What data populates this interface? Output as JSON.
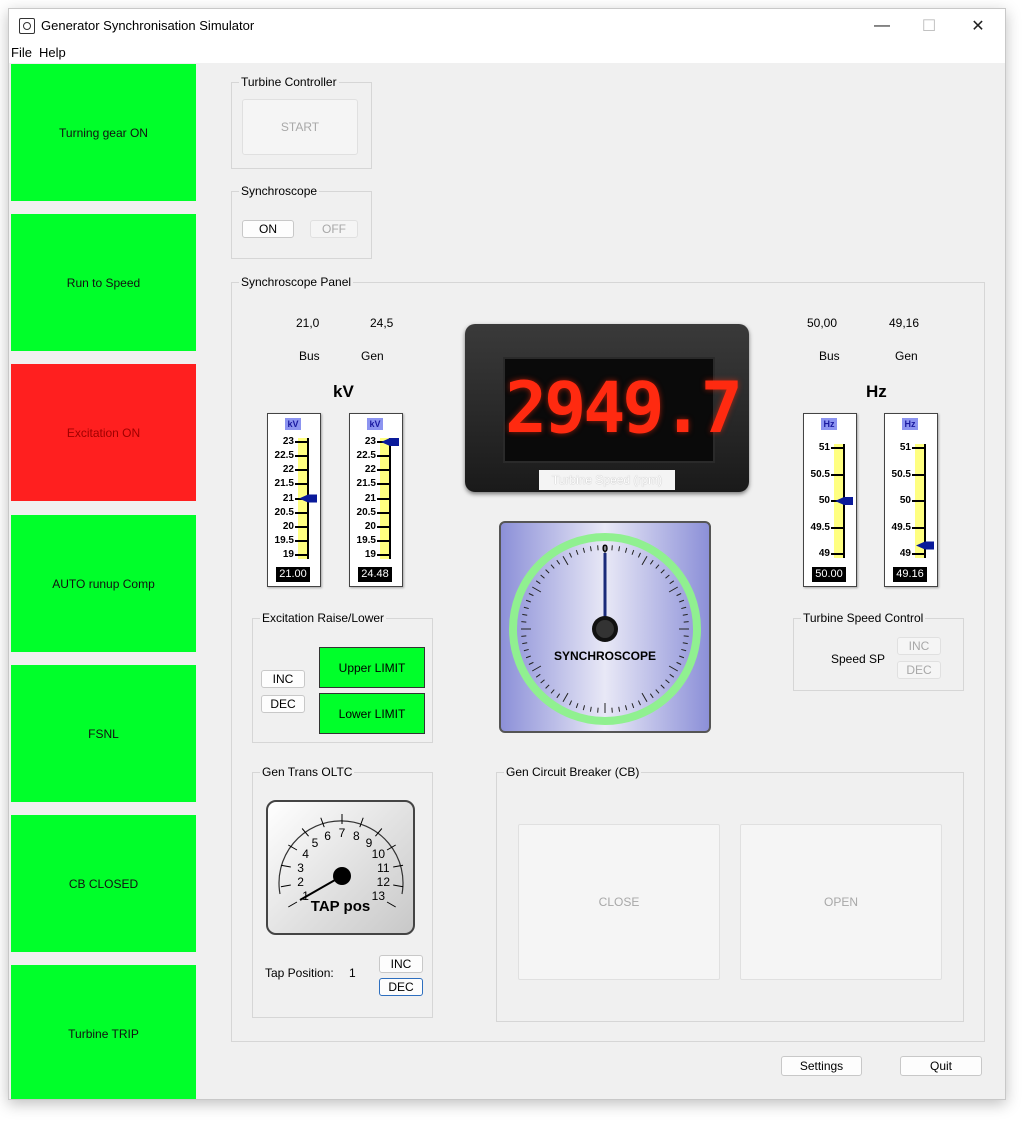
{
  "window": {
    "title": "Generator Synchronisation Simulator",
    "minimize": "—",
    "maximize": "☐",
    "close": "✕"
  },
  "menu": [
    "File",
    "Help"
  ],
  "left_buttons": [
    {
      "label": "Turning gear ON",
      "color": "#00ff2a"
    },
    {
      "label": "Run to Speed",
      "color": "#00ff2a"
    },
    {
      "label": "Excitation ON",
      "color": "#ff1f1f"
    },
    {
      "label": "AUTO runup Comp",
      "color": "#00ff2a"
    },
    {
      "label": "FSNL",
      "color": "#00ff2a"
    },
    {
      "label": "CB CLOSED",
      "color": "#00ff2a"
    },
    {
      "label": "Turbine TRIP",
      "color": "#00ff2a"
    }
  ],
  "turbine_controller": {
    "title": "Turbine Controller",
    "start": "START"
  },
  "synchroscope_toggle": {
    "title": "Synchroscope",
    "on": "ON",
    "off": "OFF"
  },
  "panel": {
    "title": "Synchroscope Panel",
    "kv": {
      "bus_value": "21,0",
      "gen_value": "24,5",
      "bus_label": "Bus",
      "gen_label": "Gen",
      "heading": "kV",
      "meter_unit": "kV",
      "ticks": [
        "23",
        "22.5",
        "22",
        "21.5",
        "21",
        "20.5",
        "20",
        "19.5",
        "19"
      ],
      "bus_reading": "21.00",
      "gen_reading": "24.48",
      "bus_level": 21.0,
      "gen_level": 24.48,
      "range": [
        19,
        23
      ]
    },
    "hz": {
      "bus_value": "50,00",
      "gen_value": "49,16",
      "bus_label": "Bus",
      "gen_label": "Gen",
      "heading": "Hz",
      "meter_unit": "Hz",
      "ticks": [
        "51",
        "50.5",
        "50",
        "49.5",
        "49"
      ],
      "bus_reading": "50.00",
      "gen_reading": "49.16",
      "bus_level": 50.0,
      "gen_level": 49.16,
      "range": [
        49,
        51
      ]
    },
    "speed_display": {
      "value": "2949.7",
      "caption": "Turbine Speed (rpm)"
    },
    "synchroscope": {
      "label": "SYNCHROSCOPE",
      "zero": "0"
    },
    "excitation": {
      "title": "Excitation Raise/Lower",
      "inc": "INC",
      "dec": "DEC",
      "upper": "Upper LIMIT",
      "lower": "Lower LIMIT"
    },
    "speed_control": {
      "title": "Turbine Speed Control",
      "label": "Speed SP",
      "inc": "INC",
      "dec": "DEC"
    },
    "oltc": {
      "title": "Gen Trans OLTC",
      "gauge_label": "TAP pos",
      "scale": [
        "1",
        "2",
        "3",
        "4",
        "5",
        "6",
        "7",
        "8",
        "9",
        "10",
        "11",
        "12",
        "13"
      ],
      "tap_label": "Tap Position:",
      "tap_value": "1",
      "inc": "INC",
      "dec": "DEC"
    },
    "breaker": {
      "title": "Gen Circuit Breaker (CB)",
      "close": "CLOSE",
      "open": "OPEN"
    }
  },
  "footer": {
    "settings": "Settings",
    "quit": "Quit"
  }
}
